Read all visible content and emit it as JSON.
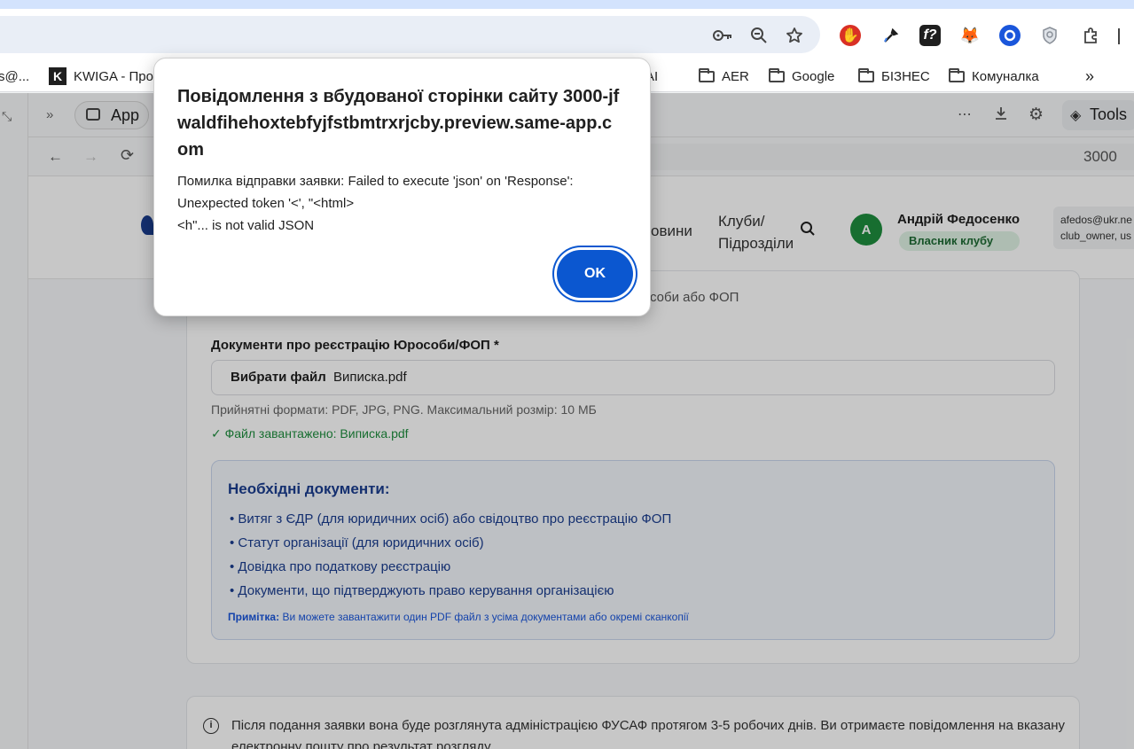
{
  "browser": {
    "bookmarks": [
      {
        "label": "s@...",
        "type": "partial"
      },
      {
        "label": "KWIGA - Про",
        "type": "site"
      },
      {
        "label": "AI",
        "type": "folder"
      },
      {
        "label": "AER",
        "type": "folder"
      },
      {
        "label": "Google",
        "type": "folder"
      },
      {
        "label": "БІЗНЕС",
        "type": "folder"
      },
      {
        "label": "Комуналка",
        "type": "folder"
      }
    ],
    "bookmarks_more": "»",
    "extensions": [
      "password-key-icon",
      "zoom-icon",
      "star-icon",
      "adblock-icon",
      "eyedropper-icon",
      "fx-icon",
      "metamask-icon",
      "target-icon",
      "shield-icon",
      "puzzle-icon"
    ]
  },
  "app_toolbar": {
    "tab_label": "App",
    "tools_label": "Tools",
    "port": "3000"
  },
  "site_header": {
    "nav_news": "овини",
    "nav_clubs": "Клуби/\nПідрозділи",
    "user_name": "Андрій Федосенко",
    "user_initial": "А",
    "user_role": "Власник клубу",
    "user_email": "afedos@ukr.ne",
    "user_role_code": "club_owner, us"
  },
  "form": {
    "hint_top": "соби або ФОП",
    "docs_label": "Документи про реєстрацію Юрособи/ФОП *",
    "choose_file": "Вибрати файл",
    "file_name": "Виписка.pdf",
    "formats_hint": "Прийнятні формати: PDF, JPG, PNG. Максимальний розмір: 10 МБ",
    "uploaded": "✓ Файл завантажено: Виписка.pdf",
    "required_title": "Необхідні документи:",
    "required_items": [
      "Витяг з ЄДР (для юридичних осіб) або свідоцтво про реєстрацію ФОП",
      "Статут організації (для юридичних осіб)",
      "Довідка про податкову реєстрацію",
      "Документи, що підтверджують право керування організацією"
    ],
    "note_label": "Примітка:",
    "note_text": " Ви можете завантажити один PDF файл з усіма документами або окремі сканкопії"
  },
  "info": {
    "text": "Після подання заявки вона буде розглянута адміністрацією ФУСАФ протягом 3-5 робочих днів. Ви отримаєте повідомлення на вказану електронну пошту про результат розгляду."
  },
  "dialog": {
    "title": "Повідомлення з вбудованої сторінки сайту 3000-jfwaldfihehoxtebfyjfstbmtrxrjcby.preview.same-app.com",
    "message": "Помилка відправки заявки: Failed to execute 'json' on 'Response': Unexpected token '<', \"<html>\n<h\"... is not valid JSON",
    "ok_label": "OK"
  },
  "colors": {
    "accent": "#0b57d0",
    "success": "#1e8e3e",
    "notice_bg": "#f2f6fc",
    "notice_text": "#1a3d8f"
  }
}
